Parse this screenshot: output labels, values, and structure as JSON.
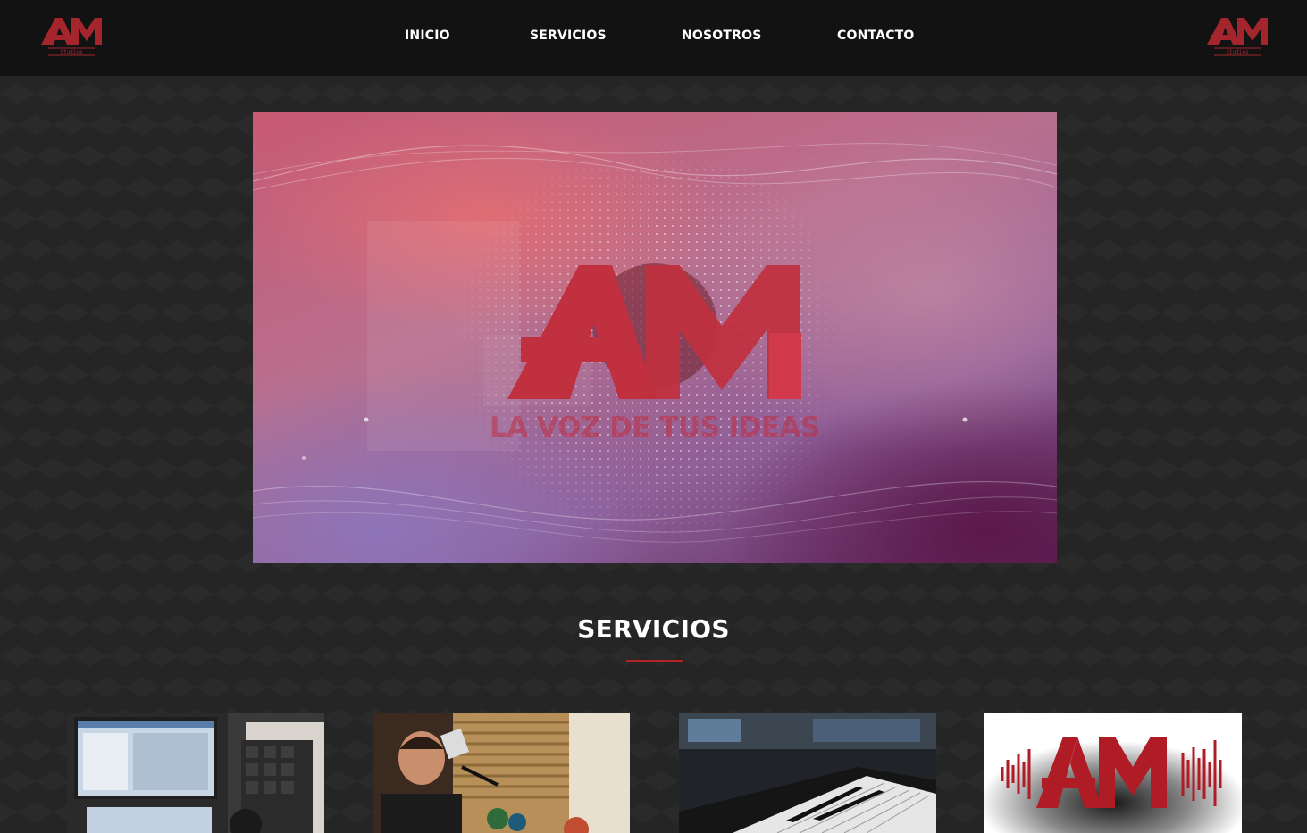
{
  "brand": {
    "logo_text": "AM",
    "logo_subtext": "Studios",
    "accent_color": "#b32424"
  },
  "nav": {
    "items": [
      {
        "label": "INICIO"
      },
      {
        "label": "SERVICIOS"
      },
      {
        "label": "NOSOTROS"
      },
      {
        "label": "CONTACTO"
      }
    ]
  },
  "hero": {
    "logo_text": "AM",
    "tagline": "LA VOZ DE TUS IDEAS"
  },
  "services": {
    "title": "SERVICIOS",
    "cards": [
      {
        "image": "recording-booth-photo"
      },
      {
        "image": "voice-artist-photo"
      },
      {
        "image": "keyboard-photo"
      },
      {
        "image": "am-soundwave-logo"
      }
    ]
  }
}
